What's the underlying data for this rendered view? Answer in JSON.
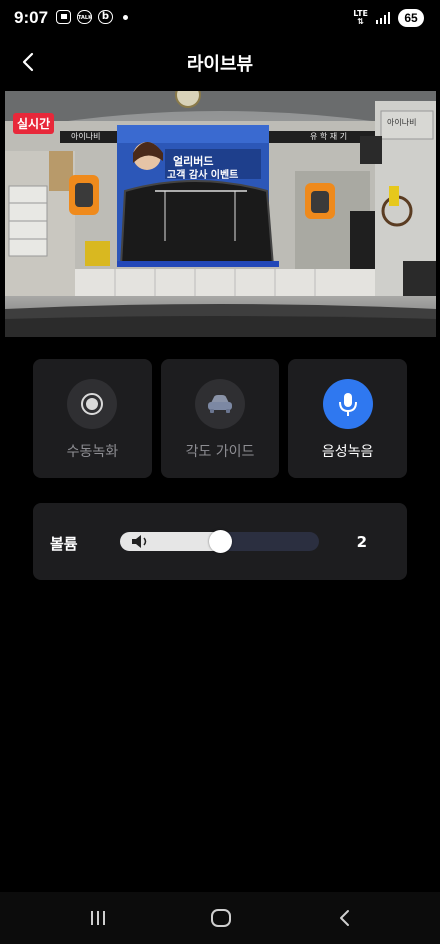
{
  "status": {
    "time": "9:07",
    "icons": [
      "screenshot-icon",
      "talk-icon",
      "b-app-icon"
    ],
    "talk_badge": "TALK",
    "b_badge": "b",
    "network": "LTE",
    "battery": "65"
  },
  "header": {
    "title": "라이브뷰",
    "back_icon": "chevron-left-icon"
  },
  "video": {
    "live_label": "실시간",
    "poster_title": "얼리버드",
    "poster_subtitle": "고객 감사 이벤트",
    "left_banner_text": "아이나비",
    "right_banner_text": "아이나비",
    "signboard_text": "유 학 재 기"
  },
  "controls": [
    {
      "label": "수동녹화",
      "icon": "record-icon",
      "active": false
    },
    {
      "label": "각도 가이드",
      "icon": "car-icon",
      "active": false
    },
    {
      "label": "음성녹음",
      "icon": "microphone-icon",
      "active": true
    }
  ],
  "volume": {
    "label": "볼륨",
    "value": "2",
    "fraction": 0.5,
    "icon": "speaker-icon"
  },
  "colors": {
    "accent": "#2f78f0",
    "live": "#e8283a",
    "card": "#1d1d1f"
  },
  "nav": [
    "recent-apps-icon",
    "home-icon",
    "back-icon"
  ]
}
